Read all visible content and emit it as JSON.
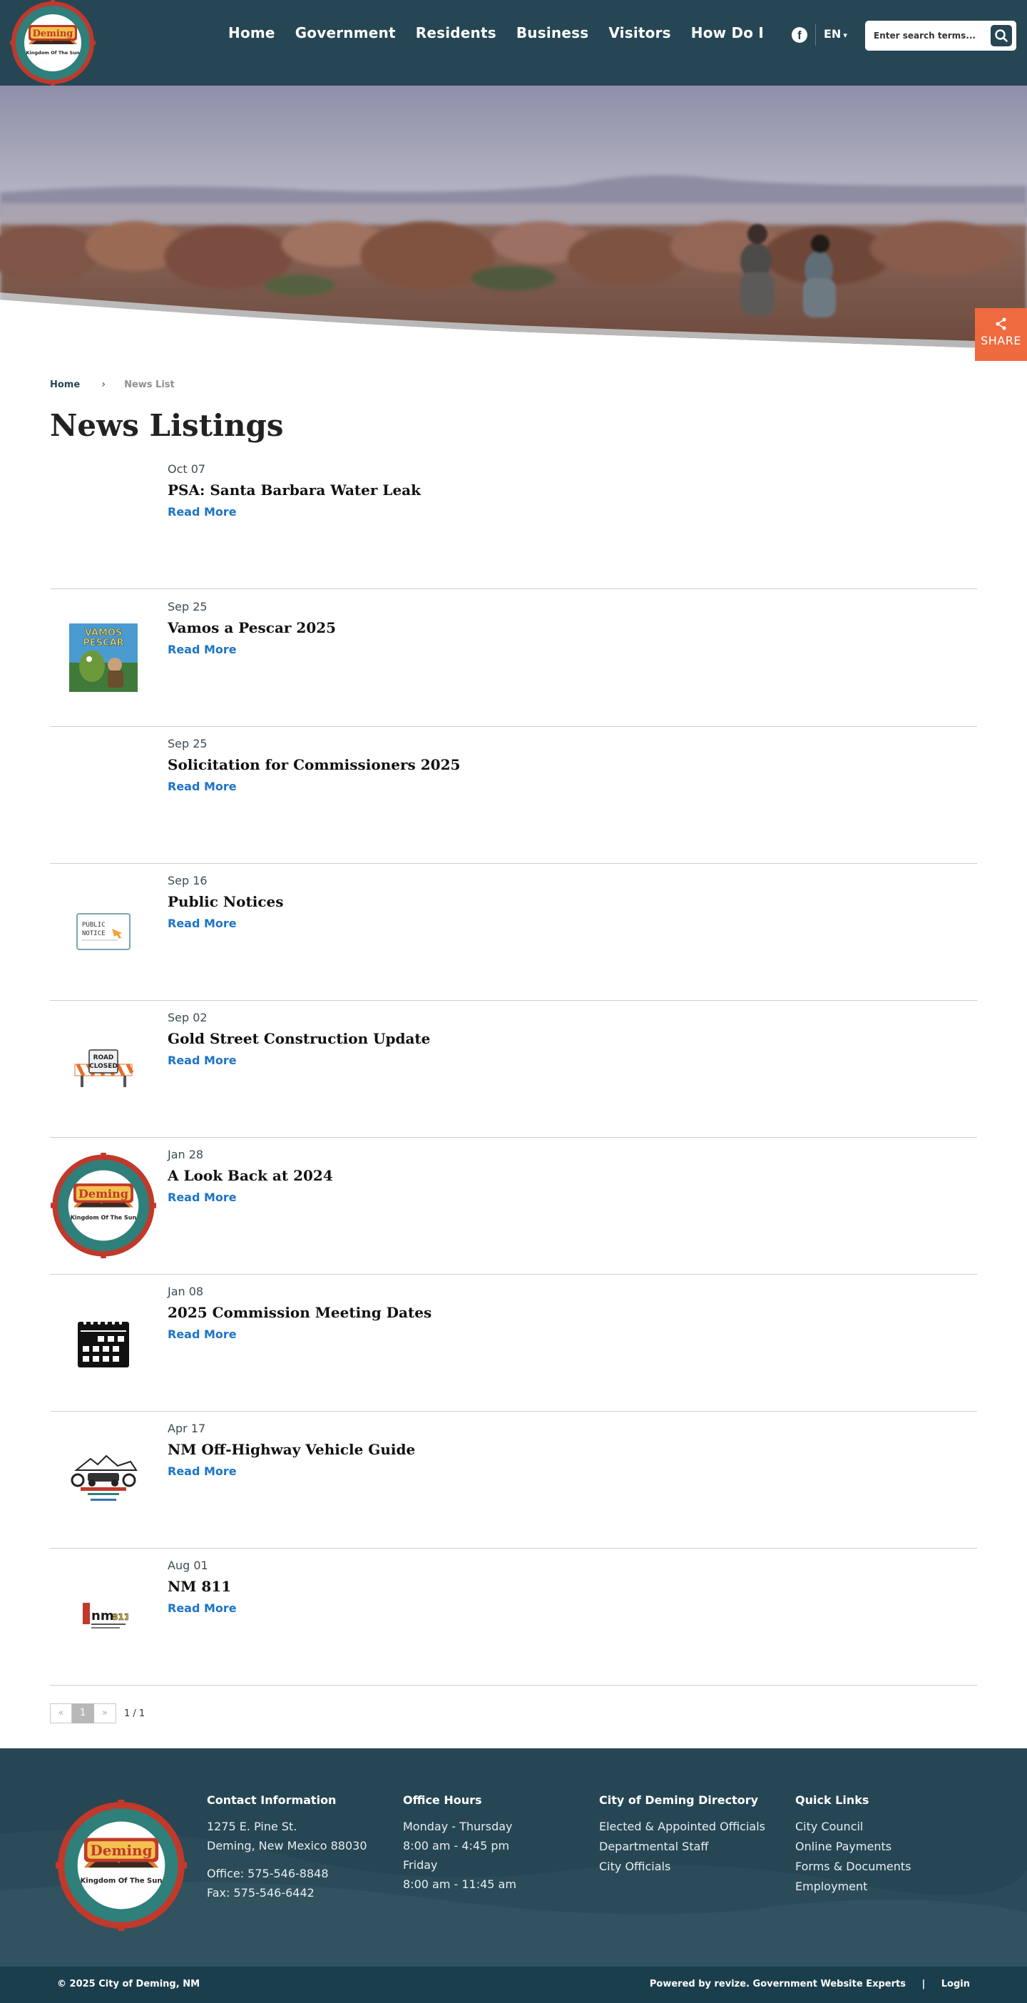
{
  "header": {
    "logo_alt": "City of Deming - Kingdom Of The Sun",
    "logo_text": "Deming",
    "logo_tagline": "Kingdom Of The Sun",
    "nav": [
      "Home",
      "Government",
      "Residents",
      "Business",
      "Visitors",
      "How Do I"
    ],
    "facebook_icon": "facebook-icon",
    "language": "EN",
    "search_placeholder": "Enter search terms...",
    "search_icon": "search-icon"
  },
  "share": {
    "label": "SHARE",
    "icon": "share-icon",
    "color": "#ef6a3f"
  },
  "breadcrumb": {
    "home": "Home",
    "current": "News List"
  },
  "page_title": "News Listings",
  "news": [
    {
      "date": "Oct 07",
      "title": "PSA: Santa Barbara Water Leak",
      "link": "Read More",
      "thumb": "none"
    },
    {
      "date": "Sep 25",
      "title": "Vamos a Pescar 2025",
      "link": "Read More",
      "thumb": "vamos-pescar-poster",
      "thumb_text": "VAMOS A PESCAR"
    },
    {
      "date": "Sep 25",
      "title": "Solicitation for Commissioners 2025",
      "link": "Read More",
      "thumb": "none"
    },
    {
      "date": "Sep 16",
      "title": "Public Notices",
      "link": "Read More",
      "thumb": "public-notice-sign",
      "thumb_text": "PUBLIC NOTICE"
    },
    {
      "date": "Sep 02",
      "title": "Gold Street Construction Update",
      "link": "Read More",
      "thumb": "road-closed-sign",
      "thumb_text": "ROAD CLOSED"
    },
    {
      "date": "Jan 28",
      "title": "A Look Back at 2024",
      "link": "Read More",
      "thumb": "deming-seal"
    },
    {
      "date": "Jan 08",
      "title": "2025 Commission Meeting Dates",
      "link": "Read More",
      "thumb": "calendar-icon"
    },
    {
      "date": "Apr 17",
      "title": "NM Off-Highway Vehicle Guide",
      "link": "Read More",
      "thumb": "ohv-guide-logo"
    },
    {
      "date": "Aug 01",
      "title": "NM 811",
      "link": "Read More",
      "thumb": "nm811-logo",
      "thumb_text": "nm811"
    }
  ],
  "pagination": {
    "prev": "«",
    "page": "1",
    "next": "»",
    "count": "1 / 1"
  },
  "footer": {
    "contact": {
      "heading": "Contact Information",
      "address1": "1275 E. Pine St.",
      "address2": "Deming, New Mexico 88030",
      "office": "Office: 575-546-8848",
      "fax": "Fax: 575-546-6442"
    },
    "hours": {
      "heading": "Office Hours",
      "line1": "Monday - Thursday",
      "line2": "8:00 am - 4:45 pm",
      "line3": "Friday",
      "line4": "8:00 am - 11:45 am"
    },
    "directory": {
      "heading": "City of Deming Directory",
      "links": [
        "Elected & Appointed Officials",
        "Departmental Staff",
        "City Officials"
      ]
    },
    "quick_links": {
      "heading": "Quick Links",
      "links": [
        "City Council",
        "Online Payments",
        "Forms & Documents",
        "Employment"
      ]
    },
    "copyright": "© 2025 City of Deming, NM",
    "powered_by": "Powered by revize. Government Website Experts",
    "login": "Login"
  },
  "colors": {
    "header_bg": "#264654",
    "link_blue": "#1c74c9",
    "accent_orange": "#ef6a3f"
  }
}
